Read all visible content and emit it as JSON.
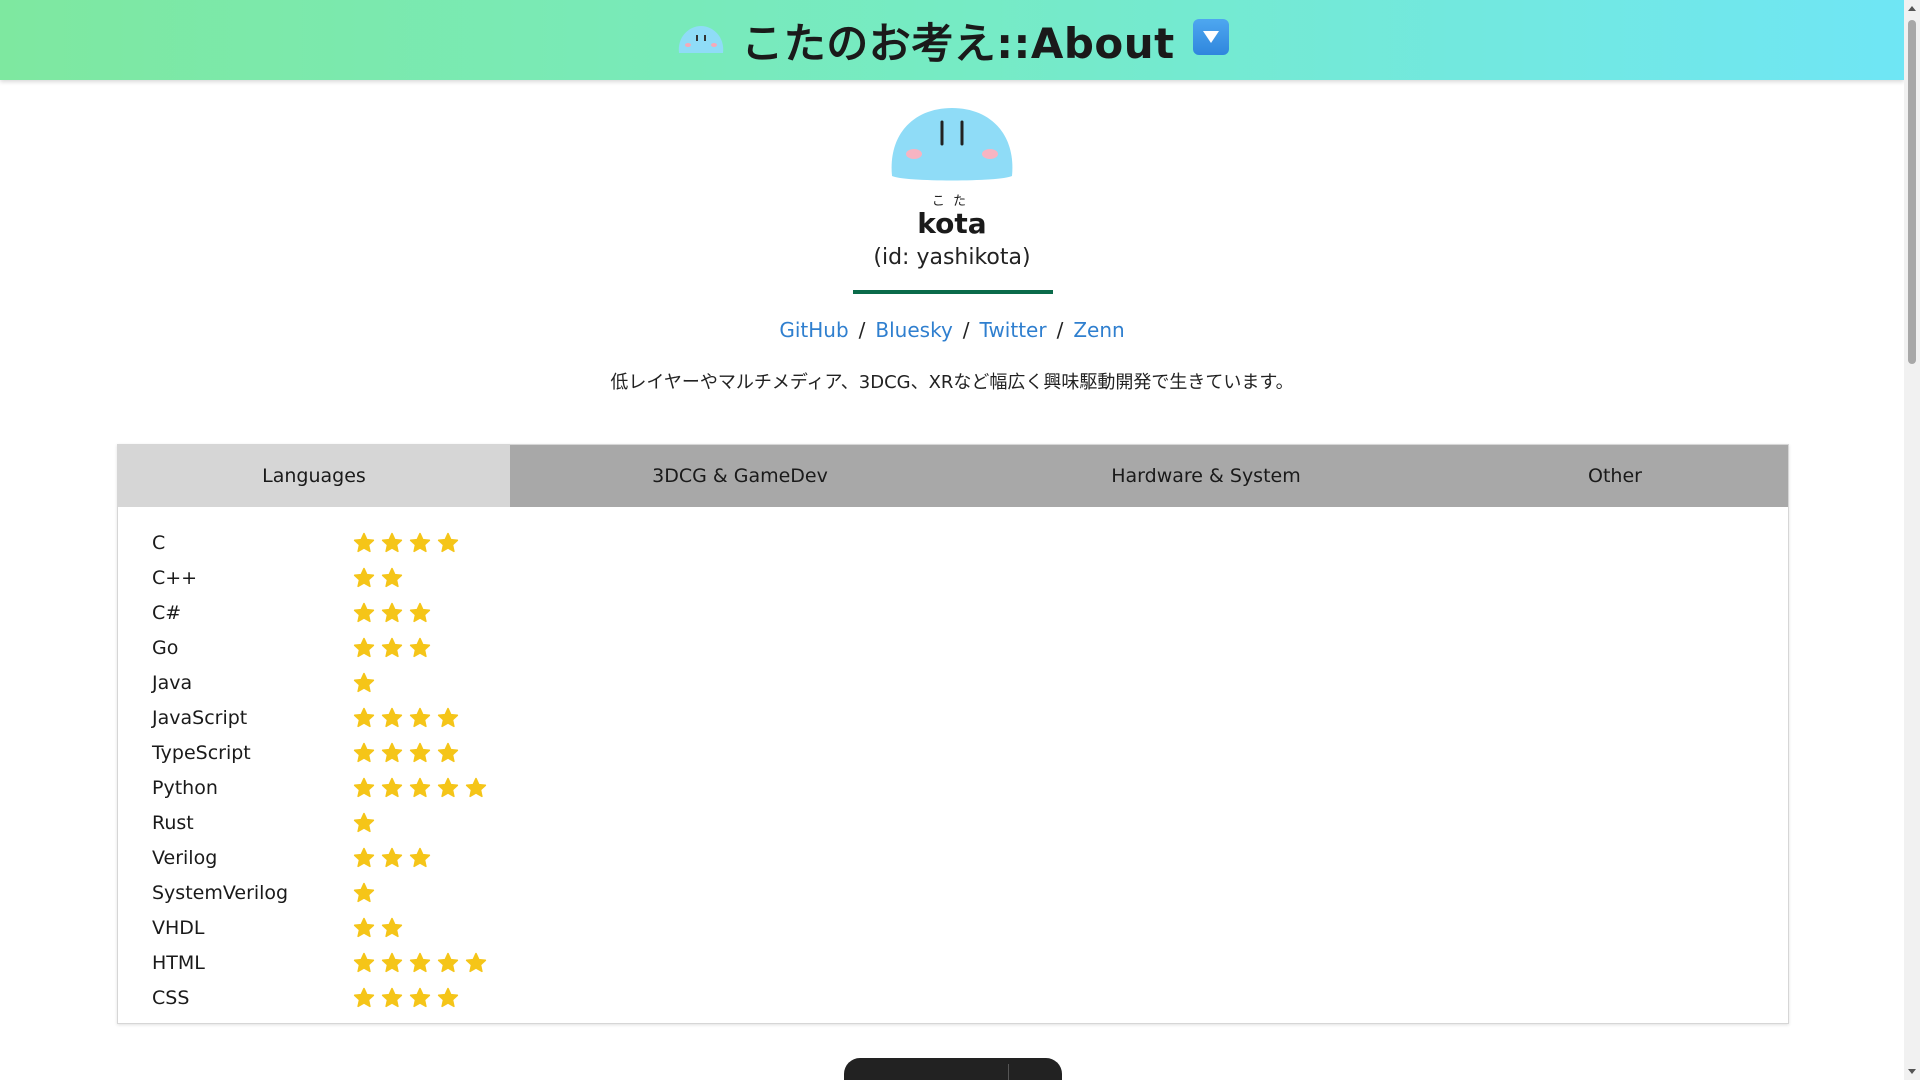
{
  "header": {
    "title": "こたのお考え::About",
    "logo_icon": "blob-icon",
    "menu_icon": "down-arrow-button-icon"
  },
  "profile": {
    "avatar_icon": "blue-blob-avatar",
    "ruby": "こ た",
    "name": "kota",
    "id": "(id: yashikota)",
    "accent_color": "#0a6b4a"
  },
  "links": [
    {
      "label": "GitHub"
    },
    {
      "label": "Bluesky"
    },
    {
      "label": "Twitter"
    },
    {
      "label": "Zenn"
    }
  ],
  "link_separator": "/",
  "bio": "低レイヤーやマルチメディア、3DCG、XRなど幅広く興味駆動開発で生きています。",
  "tabs": [
    {
      "label": "Languages",
      "active": true
    },
    {
      "label": "3DCG & GameDev",
      "active": false
    },
    {
      "label": "Hardware & System",
      "active": false
    },
    {
      "label": "Other",
      "active": false
    }
  ],
  "skills": [
    {
      "name": "C",
      "stars": 4
    },
    {
      "name": "C++",
      "stars": 2
    },
    {
      "name": "C#",
      "stars": 3
    },
    {
      "name": "Go",
      "stars": 3
    },
    {
      "name": "Java",
      "stars": 1
    },
    {
      "name": "JavaScript",
      "stars": 4
    },
    {
      "name": "TypeScript",
      "stars": 4
    },
    {
      "name": "Python",
      "stars": 5
    },
    {
      "name": "Rust",
      "stars": 1
    },
    {
      "name": "Verilog",
      "stars": 3
    },
    {
      "name": "SystemVerilog",
      "stars": 1
    },
    {
      "name": "VHDL",
      "stars": 2
    },
    {
      "name": "HTML",
      "stars": 5
    },
    {
      "name": "CSS",
      "stars": 4
    }
  ],
  "colors": {
    "header_gradient_start": "#7ee8a0",
    "header_gradient_end": "#6fe6f5",
    "link": "#2f7fcf",
    "star": "#f5c518",
    "tab_active": "#d6d6d6",
    "tab_inactive": "#a8a8a8"
  }
}
